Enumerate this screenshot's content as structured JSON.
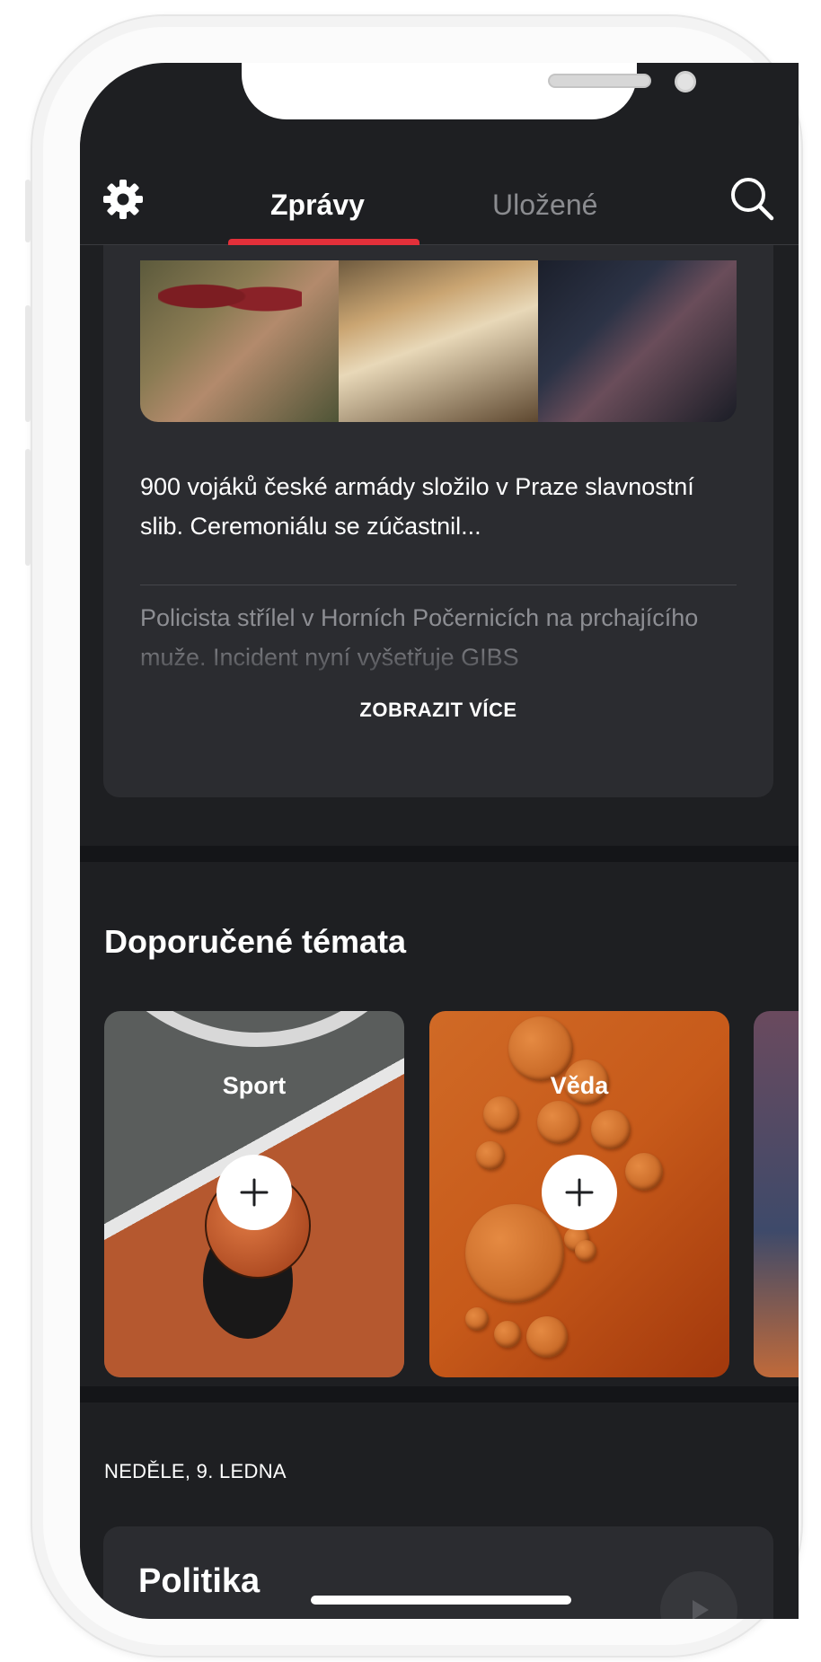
{
  "header": {
    "tabs": [
      {
        "label": "Zprávy",
        "active": true
      },
      {
        "label": "Uložené",
        "active": false
      }
    ],
    "accent_color": "#e3303a"
  },
  "news_card": {
    "headline": "900 vojáků české armády složilo v Praze slavnostní slib. Ceremoniálu se zúčastnil...",
    "secondary_headline": "Policista střílel v Horních Počernicích na prchajícího muže. Incident nyní vyšetřuje GIBS",
    "show_more_label": "ZOBRAZIT VÍCE"
  },
  "recommended": {
    "title": "Doporučené témata",
    "topics": [
      {
        "label": "Sport"
      },
      {
        "label": "Věda"
      }
    ]
  },
  "feed": {
    "date_label": "NEDĚLE, 9. LEDNA",
    "section_title": "Politika"
  },
  "colors": {
    "background": "#1e1f22",
    "card": "#2b2c30",
    "text_primary": "#ffffff",
    "text_muted": "#8b8c90"
  }
}
